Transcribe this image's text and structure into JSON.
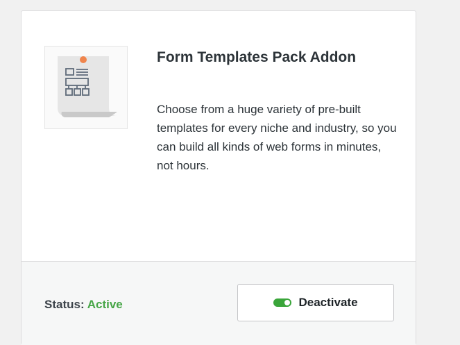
{
  "addon": {
    "title": "Form Templates Pack Addon",
    "description": "Choose from a huge variety of pre-built templates for every niche and industry, so you can build all kinds of web forms in minutes, not hours.",
    "icon": "form-templates-icon"
  },
  "footer": {
    "status_label": "Status:",
    "status_value": "Active",
    "status_color": "#46a546",
    "button_label": "Deactivate",
    "toggle_icon": "toggle-on-icon",
    "toggle_color": "#3aa53a"
  }
}
